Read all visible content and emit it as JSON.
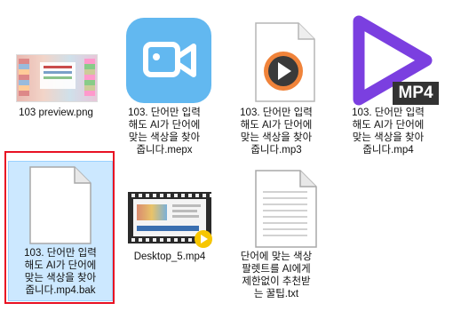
{
  "files": [
    {
      "name": "103 preview.png",
      "icon": "image-thumbnail-icon"
    },
    {
      "name": "103. 단어만 입력\n해도 AI가 단어에\n맞는 색상을 찾아\n줍니다.mepx",
      "icon": "video-editor-icon"
    },
    {
      "name": "103. 단어만 입력\n해도 AI가 단어에\n맞는 색상을 찾아\n줍니다.mp3",
      "icon": "media-player-document-icon"
    },
    {
      "name": "103. 단어만 입력\n해도 AI가 단어에\n맞는 색상을 찾아\n줍니다.mp4",
      "icon": "mp4-play-icon"
    },
    {
      "name": "103. 단어만 입력\n해도 AI가 단어에\n맞는 색상을 찾아\n줍니다.mp4.bak",
      "icon": "blank-document-icon"
    },
    {
      "name": "Desktop_5.mp4",
      "icon": "video-thumbnail-icon"
    },
    {
      "name": "단어에 맞는 색상\n팔렛트를 AI에게\n제한없이 추천받\n는 꿀팁.txt",
      "icon": "text-document-icon"
    }
  ],
  "mp4_badge": "MP4",
  "colors": {
    "selection_bg": "#cce8ff",
    "highlight_border": "#e81123",
    "mepx_blue": "#62b8f0",
    "mp4_purple": "#7b3fe0"
  }
}
